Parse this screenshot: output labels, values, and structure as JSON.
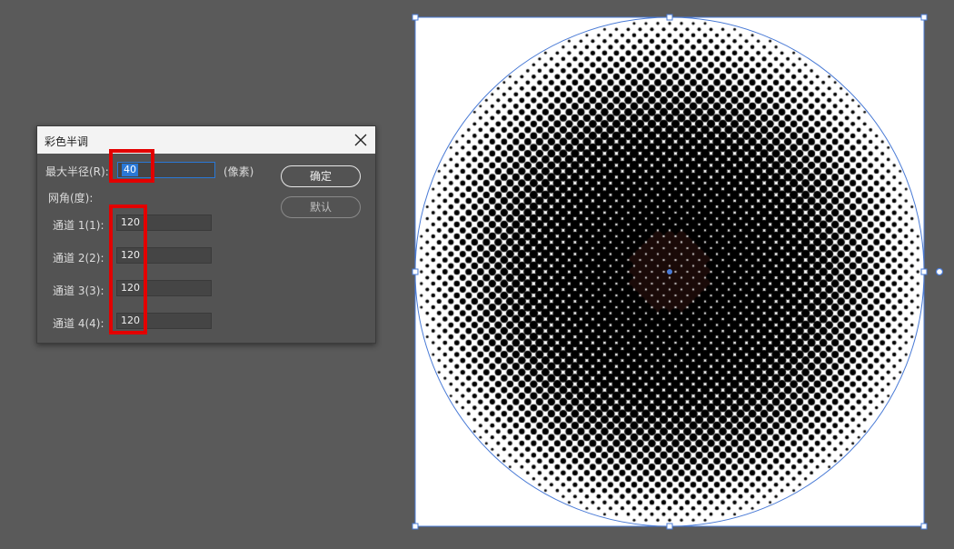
{
  "dialog": {
    "title": "彩色半调",
    "close_icon": "close-icon",
    "max_radius_label": "最大半径(R):",
    "max_radius_value": "40",
    "max_radius_unit": "(像素)",
    "screen_angles_label": "网角(度):",
    "channels": [
      {
        "label": "通道 1(1):",
        "value": "120"
      },
      {
        "label": "通道 2(2):",
        "value": "120"
      },
      {
        "label": "通道 3(3):",
        "value": "120"
      },
      {
        "label": "通道 4(4):",
        "value": "120"
      }
    ],
    "ok_label": "确定",
    "default_label": "默认"
  },
  "colors": {
    "highlight_box": "#e30000",
    "selection_blue": "#4a7bd6",
    "workspace": "#5a5a5a"
  },
  "artboard": {
    "content": "halftone-circle"
  }
}
